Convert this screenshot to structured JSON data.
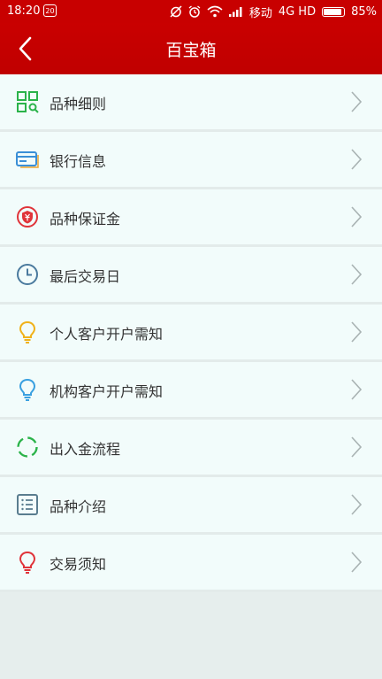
{
  "status_bar": {
    "time": "18:20",
    "notification_icon_text": "20",
    "carrier": "移动",
    "network": "4G HD",
    "battery": "85%"
  },
  "header": {
    "title": "百宝箱",
    "back_icon": "chevron-left-icon"
  },
  "menu": {
    "items": [
      {
        "label": "品种细则",
        "icon": "grid-search-icon",
        "color": "#2bb34a"
      },
      {
        "label": "银行信息",
        "icon": "bank-card-icon",
        "color": "#3b8fd6"
      },
      {
        "label": "品种保证金",
        "icon": "yen-shield-icon",
        "color": "#e0343a"
      },
      {
        "label": "最后交易日",
        "icon": "clock-icon",
        "color": "#4a7a9e"
      },
      {
        "label": "个人客户开户需知",
        "icon": "lightbulb-icon",
        "color": "#f0b21b"
      },
      {
        "label": "机构客户开户需知",
        "icon": "lightbulb-icon",
        "color": "#3aa0e0"
      },
      {
        "label": "出入金流程",
        "icon": "cycle-icon",
        "color": "#2bb34a"
      },
      {
        "label": "品种介绍",
        "icon": "list-icon",
        "color": "#5a7d8f"
      },
      {
        "label": "交易须知",
        "icon": "lightbulb-icon",
        "color": "#e0343a"
      }
    ]
  }
}
